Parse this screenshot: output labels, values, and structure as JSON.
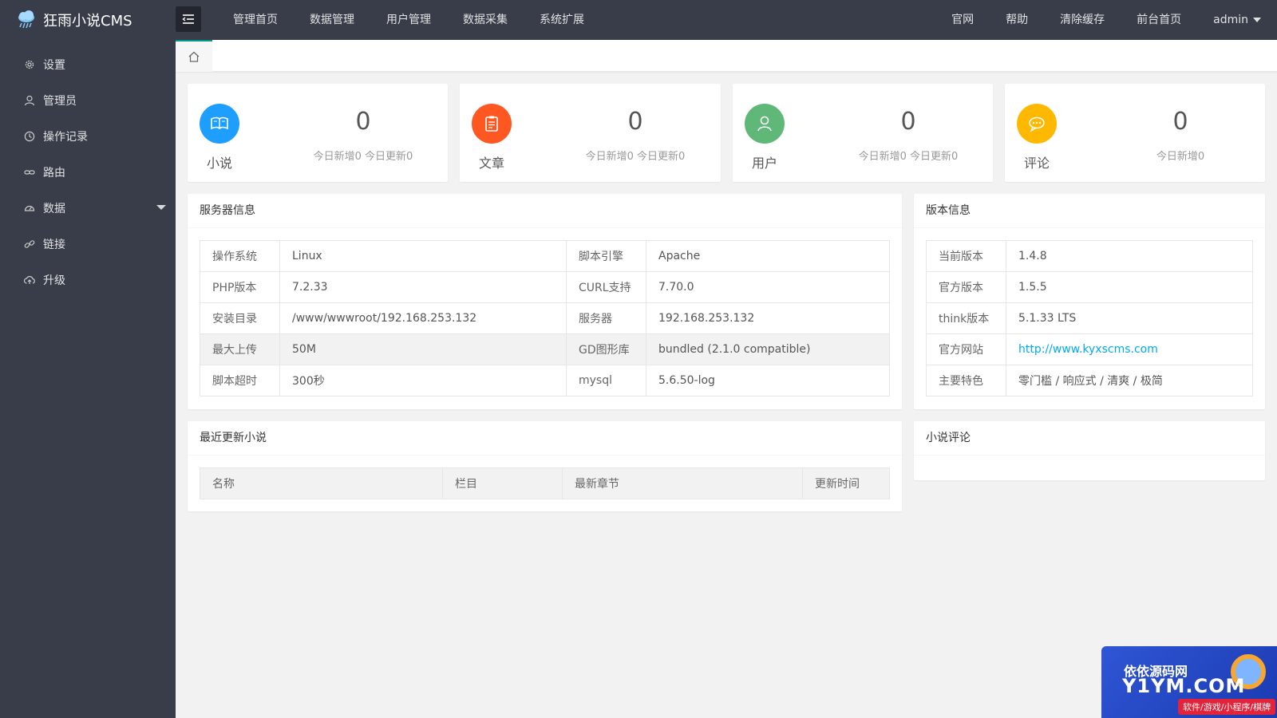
{
  "app": {
    "title": "狂雨小说CMS"
  },
  "topnav": {
    "items": [
      "管理首页",
      "数据管理",
      "用户管理",
      "数据采集",
      "系统扩展"
    ]
  },
  "rightnav": {
    "items": [
      "官网",
      "帮助",
      "清除缓存",
      "前台首页"
    ],
    "user": "admin"
  },
  "sidebar": {
    "items": [
      {
        "label": "设置",
        "icon": "gear-icon"
      },
      {
        "label": "管理员",
        "icon": "user-icon"
      },
      {
        "label": "操作记录",
        "icon": "clock-icon"
      },
      {
        "label": "路由",
        "icon": "link-chain-icon"
      },
      {
        "label": "数据",
        "icon": "gauge-icon"
      },
      {
        "label": "链接",
        "icon": "link-icon"
      },
      {
        "label": "升级",
        "icon": "cloud-upload-icon"
      }
    ]
  },
  "stats": [
    {
      "label": "小说",
      "value": "0",
      "sub": "今日新增0 今日更新0",
      "color": "#1e9fff",
      "icon": "book-icon"
    },
    {
      "label": "文章",
      "value": "0",
      "sub": "今日新增0 今日更新0",
      "color": "#ff5722",
      "icon": "clipboard-icon"
    },
    {
      "label": "用户",
      "value": "0",
      "sub": "今日新增0 今日更新0",
      "color": "#5fb878",
      "icon": "user-icon"
    },
    {
      "label": "评论",
      "value": "0",
      "sub": "今日新增0",
      "color": "#ffb800",
      "icon": "chat-icon"
    }
  ],
  "server": {
    "title": "服务器信息",
    "rows": [
      [
        "操作系统",
        "Linux",
        "脚本引擎",
        "Apache"
      ],
      [
        "PHP版本",
        "7.2.33",
        "CURL支持",
        "7.70.0"
      ],
      [
        "安装目录",
        "/www/wwwroot/192.168.253.132",
        "服务器",
        "192.168.253.132"
      ],
      [
        "最大上传",
        "50M",
        "GD图形库",
        "bundled (2.1.0 compatible)"
      ],
      [
        "脚本超时",
        "300秒",
        "mysql",
        "5.6.50-log"
      ]
    ]
  },
  "version": {
    "title": "版本信息",
    "rows": [
      [
        "当前版本",
        "1.4.8"
      ],
      [
        "官方版本",
        "1.5.5"
      ],
      [
        "think版本",
        "5.1.33 LTS"
      ],
      [
        "官方网站",
        "http://www.kyxscms.com"
      ],
      [
        "主要特色",
        "零门槛 / 响应式 / 清爽 / 极简"
      ]
    ]
  },
  "recent": {
    "title": "最近更新小说",
    "columns": [
      "名称",
      "栏目",
      "最新章节",
      "更新时间"
    ]
  },
  "comments": {
    "title": "小说评论"
  },
  "watermark": {
    "line1": "依依源码网",
    "line2": "Y1YM.COM",
    "line3": "软件/游戏/小程序/棋牌"
  }
}
